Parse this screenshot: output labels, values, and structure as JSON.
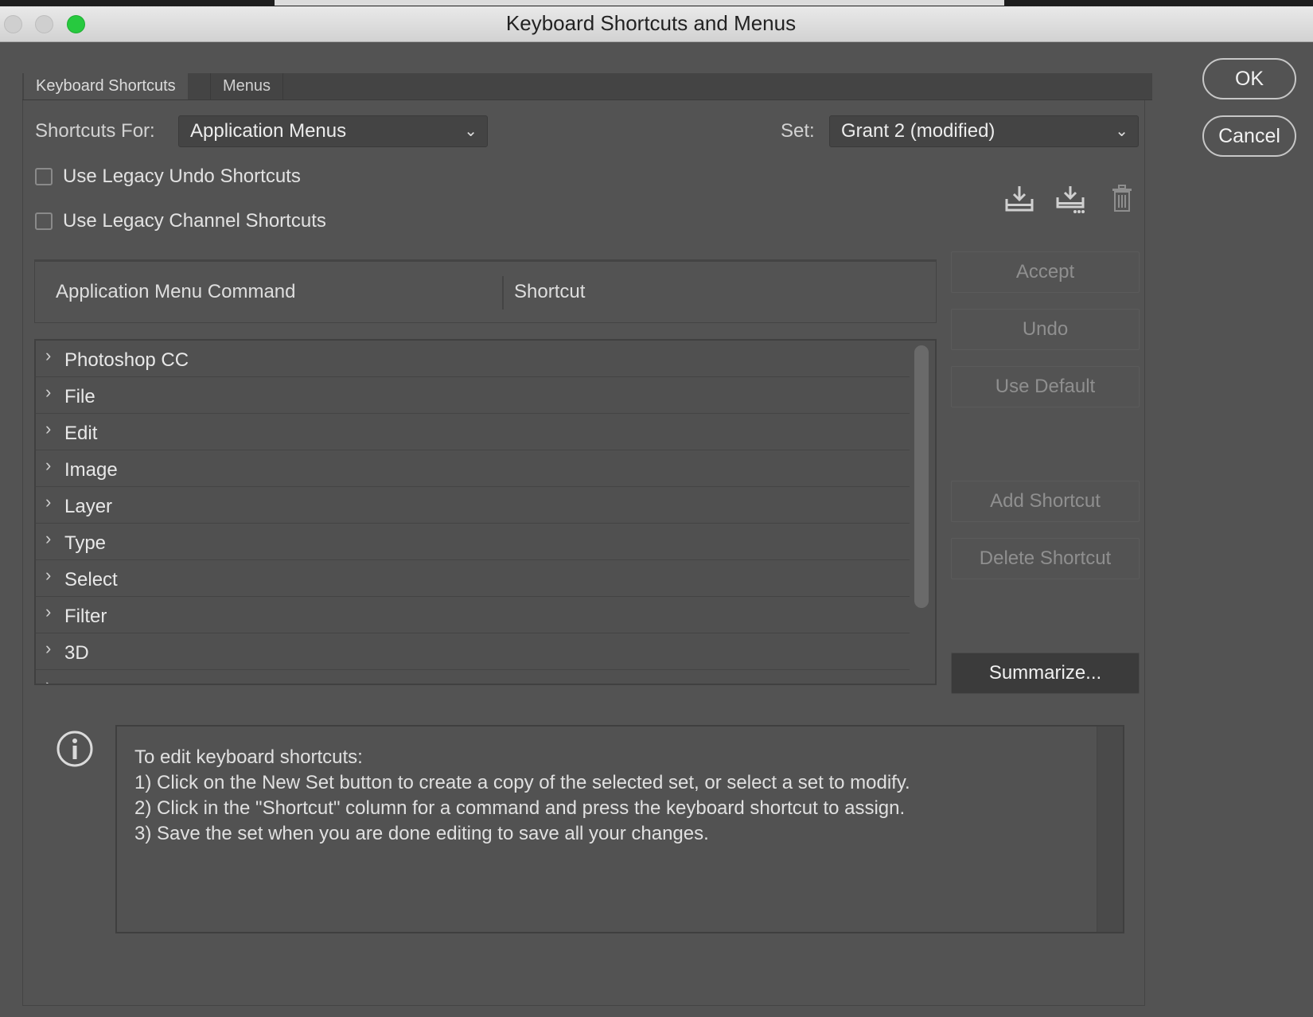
{
  "window": {
    "title": "Keyboard Shortcuts and Menus"
  },
  "tabs": [
    {
      "label": "Keyboard Shortcuts",
      "active": true
    },
    {
      "label": "Menus",
      "active": false
    }
  ],
  "shortcuts_for": {
    "label": "Shortcuts For:",
    "value": "Application Menus"
  },
  "set": {
    "label": "Set:",
    "value": "Grant 2 (modified)"
  },
  "options": [
    {
      "label": "Use Legacy Undo Shortcuts",
      "checked": false
    },
    {
      "label": "Use Legacy Channel Shortcuts",
      "checked": false
    }
  ],
  "toolbar_icons": [
    "save-set-icon",
    "save-set-as-icon",
    "delete-set-icon"
  ],
  "table": {
    "columns": [
      "Application Menu Command",
      "Shortcut"
    ],
    "rows": [
      "Photoshop CC",
      "File",
      "Edit",
      "Image",
      "Layer",
      "Type",
      "Select",
      "Filter",
      "3D"
    ]
  },
  "side_buttons": {
    "accept": "Accept",
    "undo": "Undo",
    "use_default": "Use Default",
    "add_shortcut": "Add Shortcut",
    "delete_shortcut": "Delete Shortcut",
    "summarize": "Summarize..."
  },
  "dialog_buttons": {
    "ok": "OK",
    "cancel": "Cancel"
  },
  "info": {
    "lines": [
      "To edit keyboard shortcuts:",
      "1) Click on the New Set button to create a copy of the selected set, or select a set to modify.",
      "2) Click in the \"Shortcut\" column for a command and press the keyboard shortcut to assign.",
      "3) Save the set when you are done editing to save all your changes."
    ]
  },
  "colors": {
    "background": "#535353",
    "panel": "#444444",
    "traffic_green": "#27c93f"
  }
}
